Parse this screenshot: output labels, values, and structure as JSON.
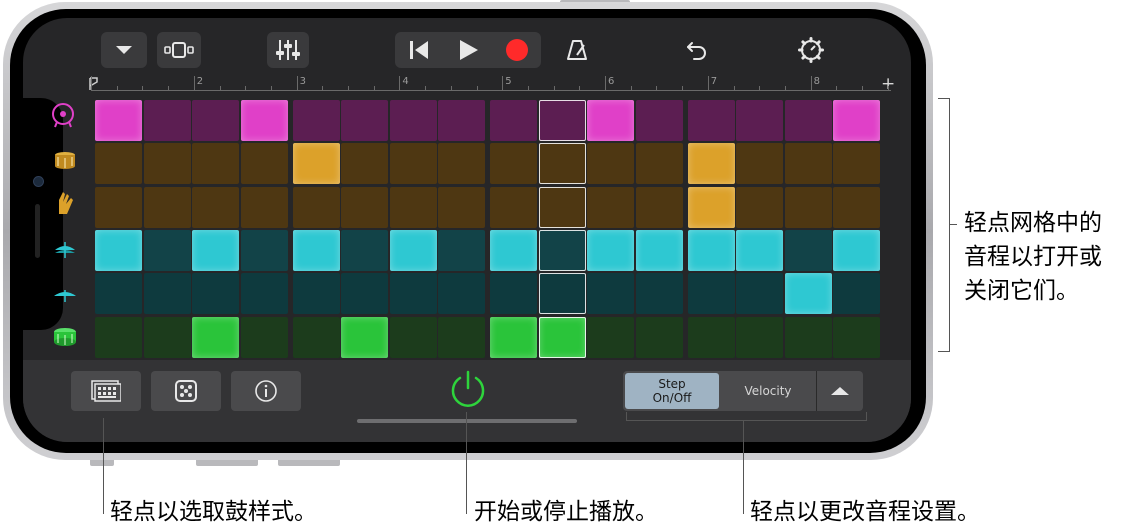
{
  "transport": {
    "buttons": [
      "menu",
      "view",
      "mixer",
      "go-to-start",
      "play",
      "record",
      "metronome",
      "undo",
      "settings"
    ],
    "record_color": "#ff2a2a"
  },
  "ruler": {
    "bars": [
      "2",
      "3",
      "4",
      "5",
      "6",
      "7",
      "8"
    ],
    "add_label": "+"
  },
  "tracks": [
    {
      "name": "kick",
      "color": "#e040c8",
      "dim": "#5c1e52",
      "pattern": [
        1,
        0,
        0,
        1,
        0,
        0,
        0,
        0,
        0,
        0,
        1,
        0,
        0,
        0,
        0,
        1
      ]
    },
    {
      "name": "snare",
      "color": "#dca12a",
      "dim": "#4e3712",
      "pattern": [
        0,
        0,
        0,
        0,
        1,
        0,
        0,
        0,
        0,
        0,
        0,
        0,
        1,
        0,
        0,
        0
      ]
    },
    {
      "name": "clap",
      "color": "#dca12a",
      "dim": "#4e3712",
      "pattern": [
        0,
        0,
        0,
        0,
        0,
        0,
        0,
        0,
        0,
        0,
        0,
        0,
        1,
        0,
        0,
        0
      ]
    },
    {
      "name": "hihat",
      "color": "#2ec8d2",
      "dim": "#124348",
      "pattern": [
        1,
        0,
        1,
        0,
        1,
        0,
        1,
        0,
        1,
        0,
        1,
        1,
        1,
        1,
        0,
        1
      ]
    },
    {
      "name": "cymbal",
      "color": "#2ec8d2",
      "dim": "#0e3a3e",
      "pattern": [
        0,
        0,
        0,
        0,
        0,
        0,
        0,
        0,
        0,
        0,
        0,
        0,
        0,
        0,
        1,
        0
      ]
    },
    {
      "name": "tom",
      "color": "#2ac43a",
      "dim": "#1c3c1c",
      "pattern": [
        0,
        0,
        1,
        0,
        0,
        1,
        0,
        0,
        1,
        1,
        0,
        0,
        0,
        0,
        0,
        0
      ]
    }
  ],
  "playhead_step": 9,
  "bottom": {
    "step_label": "Step\nOn/Off",
    "velocity_label": "Velocity"
  },
  "callouts": {
    "grid": [
      "轻点网格中的",
      "音程以打开或",
      "关闭它们。"
    ],
    "pattern": "轻点以选取鼓样式。",
    "power": "开始或停止播放。",
    "settings": "轻点以更改音程设置。"
  },
  "colors": {
    "power": "#2ed43c"
  }
}
